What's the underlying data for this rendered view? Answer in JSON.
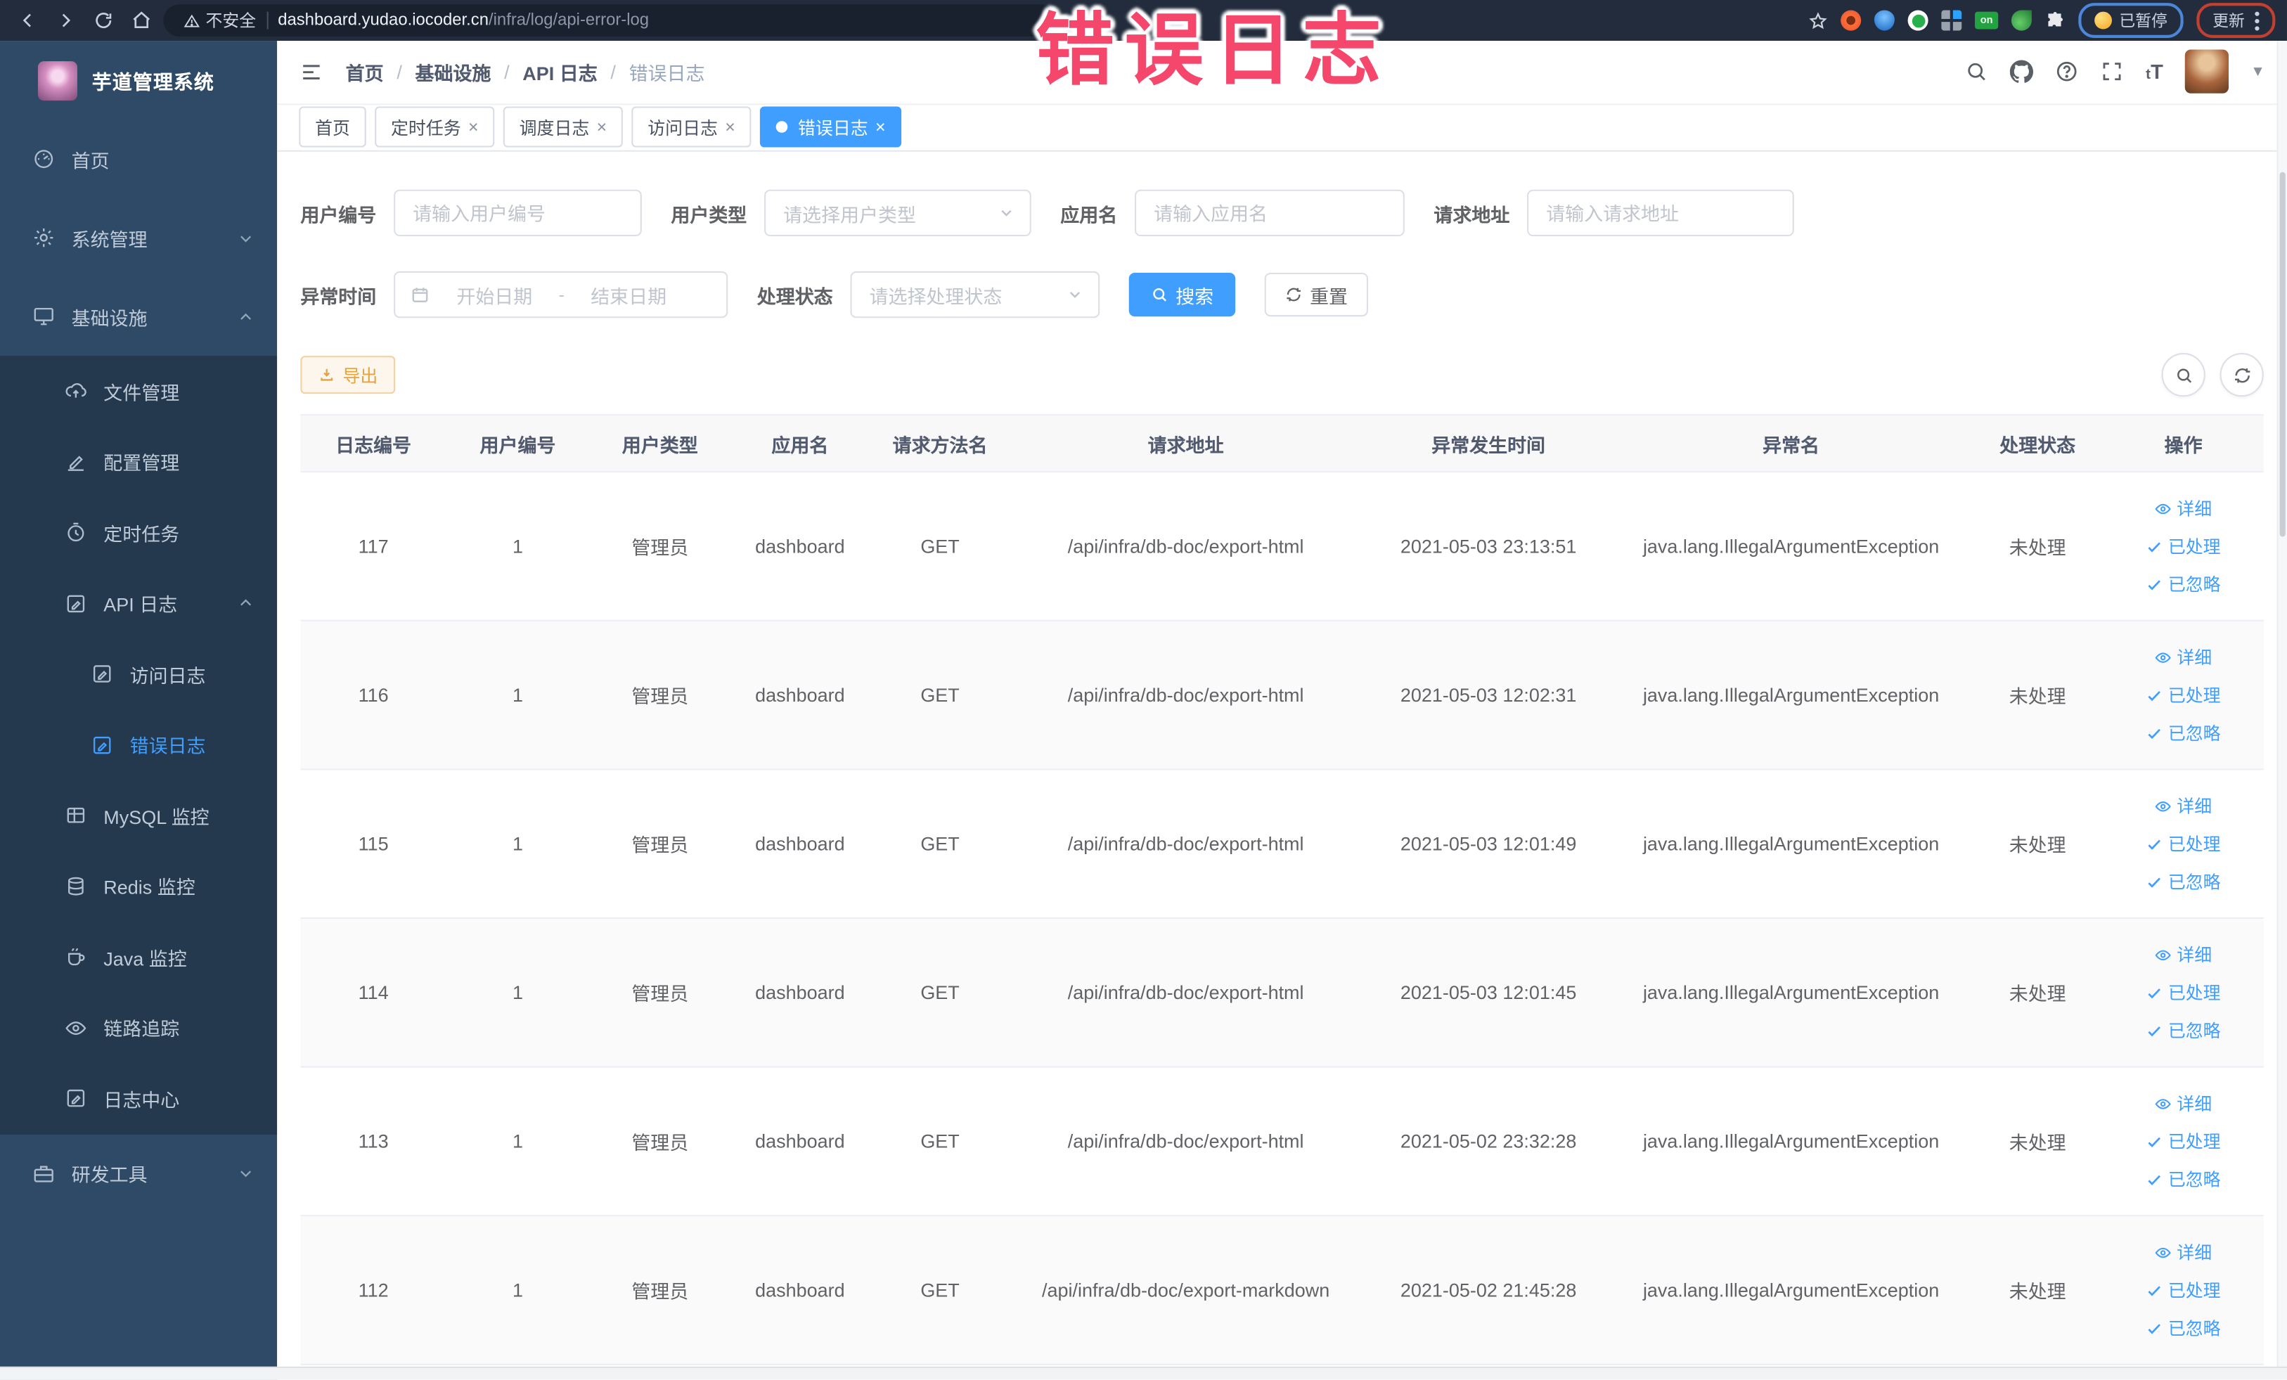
{
  "overlay_title": "错误日志",
  "colors": {
    "accent": "#409eff",
    "overlay_annotation": "#f4476b",
    "export_warning": "#e6a23c",
    "sidebar_bg": "#2f4a66"
  },
  "browser": {
    "security_label": "不安全",
    "url_host": "dashboard.yudao.iocoder.cn",
    "url_path": "/infra/log/api-error-log",
    "extension_on_badge": "on",
    "paused_label": "已暂停",
    "update_label": "更新"
  },
  "sidebar": {
    "app_title": "芋道管理系统",
    "items": [
      {
        "key": "home",
        "label": "首页",
        "icon": "dashboard",
        "level": 1,
        "sub": false
      },
      {
        "key": "system",
        "label": "系统管理",
        "icon": "gear",
        "level": 1,
        "sub": false,
        "chevron": "down"
      },
      {
        "key": "infra",
        "label": "基础设施",
        "icon": "monitor",
        "level": 1,
        "sub": false,
        "chevron": "up"
      },
      {
        "key": "file",
        "label": "文件管理",
        "icon": "cloud",
        "level": 2,
        "sub": true
      },
      {
        "key": "config",
        "label": "配置管理",
        "icon": "edit",
        "level": 2,
        "sub": true
      },
      {
        "key": "job",
        "label": "定时任务",
        "icon": "timer",
        "level": 2,
        "sub": true
      },
      {
        "key": "api-log",
        "label": "API 日志",
        "icon": "doc",
        "level": 2,
        "sub": true,
        "chevron": "up"
      },
      {
        "key": "access-log",
        "label": "访问日志",
        "icon": "doc",
        "level": 3,
        "sub": true
      },
      {
        "key": "error-log",
        "label": "错误日志",
        "icon": "doc",
        "level": 3,
        "sub": true,
        "active": true
      },
      {
        "key": "mysql",
        "label": "MySQL 监控",
        "icon": "grid",
        "level": 2,
        "sub": true
      },
      {
        "key": "redis",
        "label": "Redis 监控",
        "icon": "stack",
        "level": 2,
        "sub": true
      },
      {
        "key": "java",
        "label": "Java 监控",
        "icon": "coffee",
        "level": 2,
        "sub": true
      },
      {
        "key": "trace",
        "label": "链路追踪",
        "icon": "eye",
        "level": 2,
        "sub": true
      },
      {
        "key": "log-center",
        "label": "日志中心",
        "icon": "doc",
        "level": 2,
        "sub": true
      },
      {
        "key": "devtools",
        "label": "研发工具",
        "icon": "briefcase",
        "level": 1,
        "sub": false,
        "chevron": "down"
      }
    ]
  },
  "header": {
    "breadcrumbs": [
      "首页",
      "基础设施",
      "API 日志",
      "错误日志"
    ]
  },
  "tabs": [
    {
      "label": "首页",
      "closable": false,
      "active": false
    },
    {
      "label": "定时任务",
      "closable": true,
      "active": false
    },
    {
      "label": "调度日志",
      "closable": true,
      "active": false
    },
    {
      "label": "访问日志",
      "closable": true,
      "active": false
    },
    {
      "label": "错误日志",
      "closable": true,
      "active": true
    }
  ],
  "filters": {
    "user_id_label": "用户编号",
    "user_id_placeholder": "请输入用户编号",
    "user_type_label": "用户类型",
    "user_type_placeholder": "请选择用户类型",
    "app_name_label": "应用名",
    "app_name_placeholder": "请输入应用名",
    "request_url_label": "请求地址",
    "request_url_placeholder": "请输入请求地址",
    "exception_time_label": "异常时间",
    "date_start_placeholder": "开始日期",
    "date_separator": "-",
    "date_end_placeholder": "结束日期",
    "process_status_label": "处理状态",
    "process_status_placeholder": "请选择处理状态",
    "search_label": "搜索",
    "reset_label": "重置"
  },
  "toolbar": {
    "export_label": "导出"
  },
  "table": {
    "headers": [
      "日志编号",
      "用户编号",
      "用户类型",
      "应用名",
      "请求方法名",
      "请求地址",
      "异常发生时间",
      "异常名",
      "处理状态",
      "操作"
    ],
    "actions": {
      "detail": "详细",
      "processed": "已处理",
      "ignored": "已忽略"
    },
    "rows": [
      {
        "id": "117",
        "user_id": "1",
        "user_type": "管理员",
        "app_name": "dashboard",
        "method": "GET",
        "url": "/api/infra/db-doc/export-html",
        "time": "2021-05-03 23:13:51",
        "exception": "java.lang.IllegalArgumentException",
        "status": "未处理"
      },
      {
        "id": "116",
        "user_id": "1",
        "user_type": "管理员",
        "app_name": "dashboard",
        "method": "GET",
        "url": "/api/infra/db-doc/export-html",
        "time": "2021-05-03 12:02:31",
        "exception": "java.lang.IllegalArgumentException",
        "status": "未处理"
      },
      {
        "id": "115",
        "user_id": "1",
        "user_type": "管理员",
        "app_name": "dashboard",
        "method": "GET",
        "url": "/api/infra/db-doc/export-html",
        "time": "2021-05-03 12:01:49",
        "exception": "java.lang.IllegalArgumentException",
        "status": "未处理"
      },
      {
        "id": "114",
        "user_id": "1",
        "user_type": "管理员",
        "app_name": "dashboard",
        "method": "GET",
        "url": "/api/infra/db-doc/export-html",
        "time": "2021-05-03 12:01:45",
        "exception": "java.lang.IllegalArgumentException",
        "status": "未处理"
      },
      {
        "id": "113",
        "user_id": "1",
        "user_type": "管理员",
        "app_name": "dashboard",
        "method": "GET",
        "url": "/api/infra/db-doc/export-html",
        "time": "2021-05-02 23:32:28",
        "exception": "java.lang.IllegalArgumentException",
        "status": "未处理"
      },
      {
        "id": "112",
        "user_id": "1",
        "user_type": "管理员",
        "app_name": "dashboard",
        "method": "GET",
        "url": "/api/infra/db-doc/export-markdown",
        "time": "2021-05-02 21:45:28",
        "exception": "java.lang.IllegalArgumentException",
        "status": "未处理"
      }
    ]
  }
}
